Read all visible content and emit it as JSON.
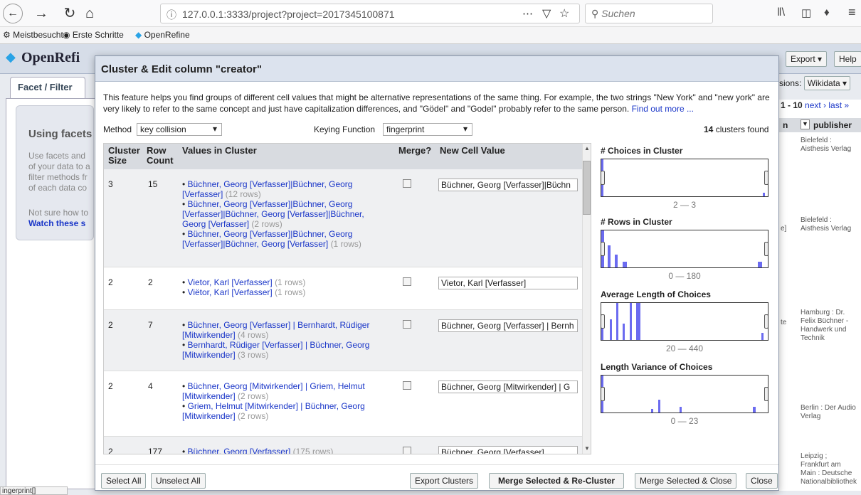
{
  "browser": {
    "url": "127.0.0.1:3333/project?project=2017345100871",
    "search_placeholder": "Suchen",
    "bookmarks": [
      "Meistbesucht",
      "Erste Schritte",
      "OpenRefine"
    ]
  },
  "app": {
    "logo": "OpenRefi",
    "facet_tab": "Facet / Filter",
    "using_title": "Using facets",
    "using_lines": [
      "Use facets and",
      "of your data to a",
      "filter methods fr",
      "of each data co"
    ],
    "not_sure": "Not sure how to",
    "watch": "Watch these s",
    "export_label": "Export ▾",
    "help_label": "Help",
    "extensions": "sions:",
    "wikidata": "Wikidata ▾",
    "pager": "1 - 10",
    "next": "next ›",
    "last": "last »",
    "col_publisher": "publisher",
    "col_n": "n",
    "right_cells": [
      "Bielefeld : Aisthesis Verlag",
      "Bielefeld : Aisthesis Verlag",
      "Hamburg : Dr. Felix Büchner - Handwerk und Technik",
      "Berlin : Der Audio Verlag",
      "Leipzig ; Frankfurt am Main : Deutsche Nationalbibliothek"
    ],
    "side_frag_1": "e]",
    "side_frag_2": "te",
    "status": "ingerprint[]"
  },
  "dialog": {
    "title": "Cluster & Edit column \"creator\"",
    "intro": "This feature helps you find groups of different cell values that might be alternative representations of the same thing. For example, the two strings \"New York\" and \"new york\" are very likely to refer to the same concept and just have capitalization differences, and \"Gödel\" and \"Godel\" probably refer to the same person.",
    "learn_more": "Find out more ...",
    "method_label": "Method",
    "method_value": "key collision",
    "keying_label": "Keying Function",
    "keying_value": "fingerprint",
    "clusters_count": "14",
    "clusters_found": "clusters found",
    "headers": {
      "cluster_size": "Cluster Size",
      "row_count": "Row Count",
      "values": "Values in Cluster",
      "merge": "Merge?",
      "new_value": "New Cell Value"
    },
    "rows": [
      {
        "size": "3",
        "count": "15",
        "new_value": "Büchner, Georg [Verfasser]|Büchn",
        "values": [
          {
            "text": "Büchner, Georg [Verfasser]|Büchner, Georg [Verfasser]",
            "rows": "(12 rows)"
          },
          {
            "text": "Büchner, Georg [Verfasser]|Büchner, Georg [Verfasser]|Büchner, Georg [Verfasser]|Büchner, Georg [Verfasser]",
            "rows": "(2 rows)"
          },
          {
            "text": "Büchner, Georg [Verfasser]|Büchner, Georg [Verfasser]|Büchner, Georg [Verfasser]",
            "rows": "(1 rows)"
          }
        ]
      },
      {
        "size": "2",
        "count": "2",
        "new_value": "Vietor, Karl [Verfasser]",
        "values": [
          {
            "text": "Vietor, Karl [Verfasser]",
            "rows": "(1 rows)"
          },
          {
            "text": "Viëtor, Karl [Verfasser]",
            "rows": "(1 rows)"
          }
        ]
      },
      {
        "size": "2",
        "count": "7",
        "new_value": "Büchner, Georg [Verfasser] | Bernh",
        "values": [
          {
            "text": "Büchner, Georg [Verfasser] | Bernhardt, Rüdiger [Mitwirkender]",
            "rows": "(4 rows)"
          },
          {
            "text": "Bernhardt, Rüdiger [Verfasser] | Büchner, Georg [Mitwirkender]",
            "rows": "(3 rows)"
          }
        ]
      },
      {
        "size": "2",
        "count": "4",
        "new_value": "Büchner, Georg [Mitwirkender] | G",
        "values": [
          {
            "text": "Büchner, Georg [Mitwirkender] | Griem, Helmut [Mitwirkender]",
            "rows": "(2 rows)"
          },
          {
            "text": "Griem, Helmut [Mitwirkender] | Büchner, Georg [Mitwirkender]",
            "rows": "(2 rows)"
          }
        ]
      },
      {
        "size": "2",
        "count": "177",
        "new_value": "Büchner, Georg [Verfasser]",
        "values": [
          {
            "text": "Büchner, Georg [Verfasser]",
            "rows": "(175 rows)"
          }
        ]
      }
    ],
    "facets": [
      {
        "title": "# Choices in Cluster",
        "range": "2 — 3",
        "bars": [
          [
            0,
            1.0,
            3
          ],
          [
            97,
            0.1,
            3
          ]
        ]
      },
      {
        "title": "# Rows in Cluster",
        "range": "0 — 180",
        "bars": [
          [
            0,
            1.0,
            4
          ],
          [
            4,
            0.6,
            4
          ],
          [
            8,
            0.35,
            4
          ],
          [
            13,
            0.15,
            6
          ],
          [
            94,
            0.15,
            6
          ]
        ]
      },
      {
        "title": "Average Length of Choices",
        "range": "20 — 440",
        "bars": [
          [
            0,
            0.45,
            3
          ],
          [
            5,
            0.55,
            3
          ],
          [
            9,
            1.0,
            3
          ],
          [
            13,
            0.45,
            3
          ],
          [
            17,
            1.0,
            3
          ],
          [
            21,
            1.0,
            6
          ],
          [
            96,
            0.2,
            3
          ]
        ]
      },
      {
        "title": "Length Variance of Choices",
        "range": "0 — 23",
        "bars": [
          [
            0,
            1.0,
            3
          ],
          [
            30,
            0.1,
            3
          ],
          [
            34,
            0.35,
            3
          ],
          [
            47,
            0.15,
            3
          ],
          [
            91,
            0.15,
            4
          ]
        ]
      }
    ],
    "buttons": {
      "select_all": "Select All",
      "unselect_all": "Unselect All",
      "export_clusters": "Export Clusters",
      "merge_recluster": "Merge Selected & Re-Cluster",
      "merge_close": "Merge Selected & Close",
      "close": "Close"
    }
  },
  "colors": {
    "link": "#1a36c8",
    "bar": "#6b6bf0",
    "title_bg": "#dce3ee"
  }
}
